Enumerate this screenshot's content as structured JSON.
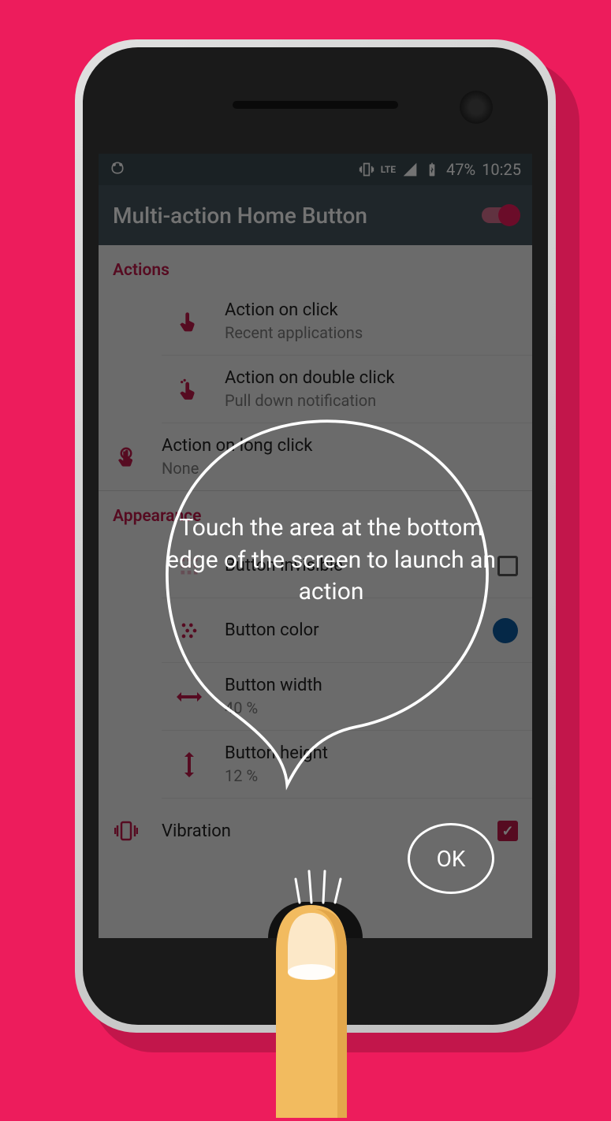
{
  "status": {
    "battery_text": "47%",
    "time": "10:25",
    "lte_label": "LTE"
  },
  "app": {
    "title": "Multi-action Home Button"
  },
  "sections": {
    "actions_header": "Actions",
    "appearance_header": "Appearance"
  },
  "items": {
    "click": {
      "title": "Action on click",
      "sub": "Recent applications"
    },
    "double": {
      "title": "Action on double click",
      "sub": "Pull down notification"
    },
    "long": {
      "title": "Action on long click",
      "sub": "None"
    },
    "invisible": {
      "title": "Button invisible"
    },
    "color": {
      "title": "Button color"
    },
    "width": {
      "title": "Button width",
      "sub": "40 %"
    },
    "height": {
      "title": "Button height",
      "sub": "12 %"
    },
    "vibration": {
      "title": "Vibration"
    }
  },
  "overlay": {
    "message": "Touch the area at the bottom edge of the screen to launch an action",
    "ok_label": "OK"
  },
  "colors": {
    "accent": "#ed1c5c"
  }
}
